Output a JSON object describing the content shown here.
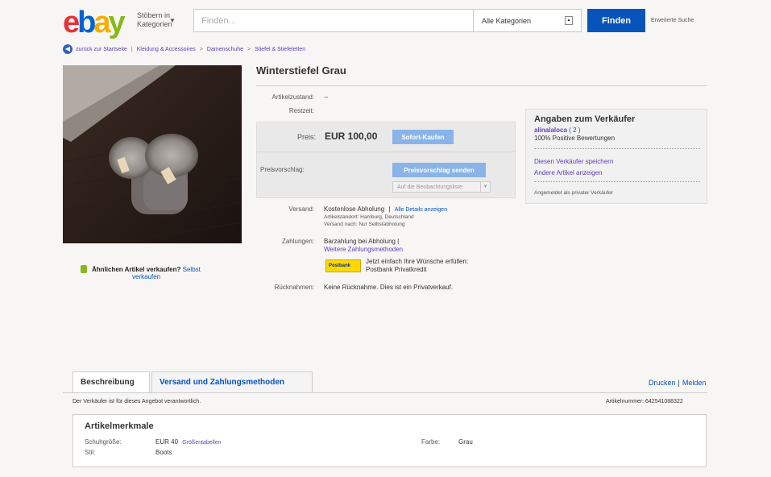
{
  "header": {
    "logo": [
      "e",
      "b",
      "a",
      "y"
    ],
    "browse_line1": "Stöbern in",
    "browse_line2": "Kategorien",
    "search_placeholder": "Finden...",
    "category": "Alle Kategorien",
    "find_label": "Finden",
    "advanced_search": "Erweiterte Suche"
  },
  "breadcrumb": {
    "back": "zurück zur Startseite",
    "path": [
      "Kleidung & Accessoires",
      "Damenschuhe",
      "Stiefel & Stiefeletten"
    ]
  },
  "sell_similar": {
    "question": "Ähnlichen Artikel verkaufen?",
    "link1": "Selbst",
    "link2": "verkaufen"
  },
  "item": {
    "title": "Winterstiefel Grau",
    "condition_label": "Artikelzustand:",
    "condition_value": "--",
    "time_left_label": "Restzeit:",
    "price_label": "Preis:",
    "price_value": "EUR 100,00",
    "buy_now_label": "Sofort-Kaufen",
    "offer_label": "Preisvorschlag:",
    "offer_button": "Preisvorschlag senden",
    "watch_button": "Auf die Beobachtungsliste",
    "shipping_label": "Versand:",
    "shipping_value": "Kostenlose Abholung",
    "shipping_details_link": "Alle Details anzeigen",
    "item_location": "Artikelstandort: Hamburg, Deutschland",
    "ships_to": "Versand nach: Nur Selbstabholung",
    "payments_label": "Zahlungen:",
    "payments_value": "Barzahlung bei Abholung |",
    "more_payments_link": "Weitere Zahlungsmethoden",
    "postbank_logo_text": "Postbank",
    "postbank_text": "Jetzt einfach Ihre Wünsche erfüllen:",
    "postbank_link": "Postbank Privatkredit",
    "returns_label": "Rücknahmen:",
    "returns_value": "Keine Rücknahme. Dies ist ein Privatverkauf."
  },
  "seller": {
    "heading": "Angaben zum Verkäufer",
    "name": "alinalaloca",
    "feedback": "( 2 )",
    "positive": "100% Positive Bewertungen",
    "save_seller": "Diesen Verkäufer speichern",
    "other_items": "Andere Artikel anzeigen",
    "note": "Angemeldet als privater Verkäufer"
  },
  "tabs": {
    "description": "Beschreibung",
    "shipping_payment": "Versand und Zahlungsmethoden",
    "print": "Drucken",
    "report": "Melden",
    "seller_responsible": "Der Verkäufer ist für dieses Angebot verantwortlich.",
    "item_number": "Artikelnummer: 642541088322"
  },
  "specs": {
    "heading": "Artikelmerkmale",
    "size_label": "Schuhgröße:",
    "size_value": "EUR 40",
    "size_link": "Größentabellen",
    "style_label": "Stil:",
    "style_value": "Boots",
    "color_label": "Farbe:",
    "color_value": "Grau"
  },
  "colors": {
    "primary_blue": "#0654ba",
    "link_purple": "#5d3fb5",
    "button_disabled_blue": "#8ab4e8"
  }
}
